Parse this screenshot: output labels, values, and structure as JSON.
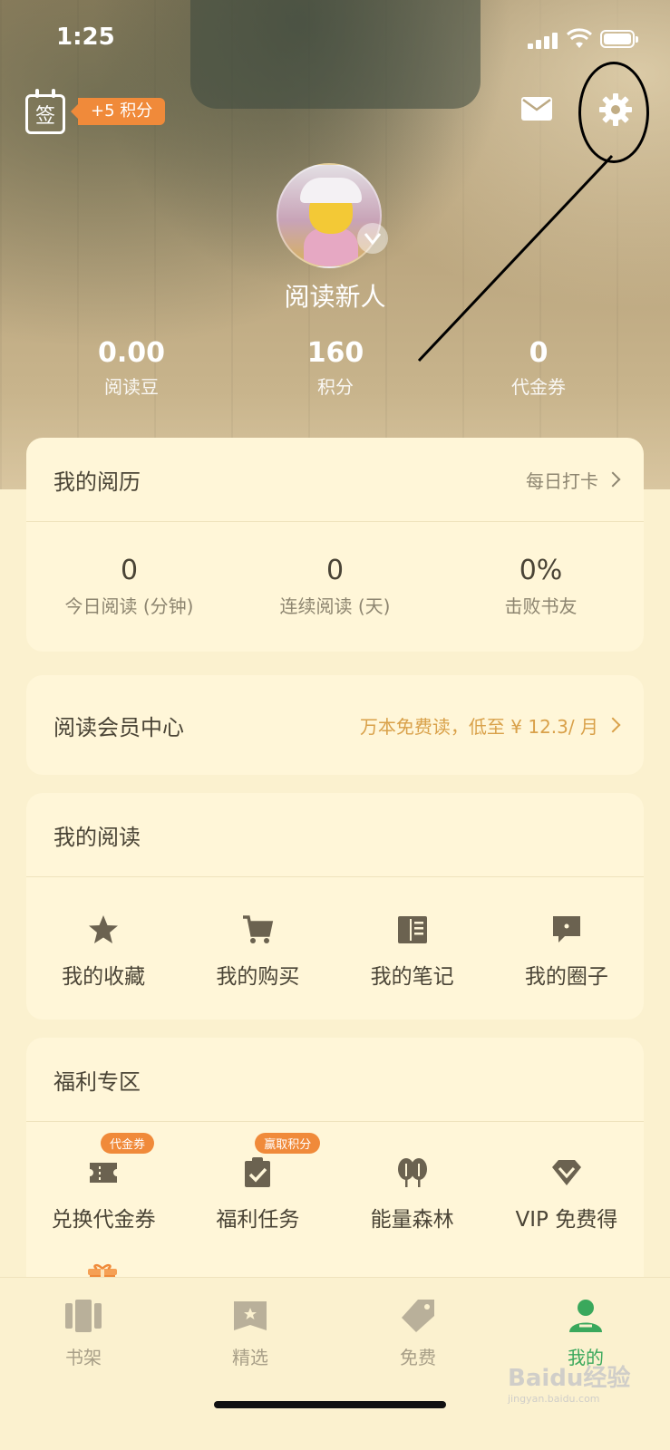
{
  "status": {
    "time": "1:25"
  },
  "header": {
    "checkin_glyph": "签",
    "points_badge": "+5 积分",
    "username": "阅读新人"
  },
  "stats": [
    {
      "value": "0.00",
      "label": "阅读豆"
    },
    {
      "value": "160",
      "label": "积分"
    },
    {
      "value": "0",
      "label": "代金券"
    }
  ],
  "history": {
    "title": "我的阅历",
    "action": "每日打卡",
    "items": [
      {
        "value": "0",
        "label": "今日阅读 (分钟)"
      },
      {
        "value": "0",
        "label": "连续阅读 (天)"
      },
      {
        "value": "0%",
        "label": "击败书友"
      }
    ]
  },
  "member": {
    "title": "阅读会员中心",
    "promo": "万本免费读，低至 ¥ 12.3/ 月"
  },
  "my_reading": {
    "title": "我的阅读",
    "items": [
      {
        "label": "我的收藏",
        "icon": "star-icon"
      },
      {
        "label": "我的购买",
        "icon": "cart-icon"
      },
      {
        "label": "我的笔记",
        "icon": "notebook-icon"
      },
      {
        "label": "我的圈子",
        "icon": "chat-bubble-icon"
      }
    ]
  },
  "welfare": {
    "title": "福利专区",
    "items": [
      {
        "label": "兑换代金券",
        "icon": "ticket-icon",
        "tag": "代金券"
      },
      {
        "label": "福利任务",
        "icon": "task-clipboard-icon",
        "tag": "赢取积分"
      },
      {
        "label": "能量森林",
        "icon": "trees-icon",
        "tag": ""
      },
      {
        "label": "VIP 免费得",
        "icon": "diamond-icon",
        "tag": ""
      }
    ],
    "extra_icon": "gift-icon"
  },
  "tabs": [
    {
      "label": "书架",
      "icon": "bookshelf-icon"
    },
    {
      "label": "精选",
      "icon": "featured-book-icon"
    },
    {
      "label": "免费",
      "icon": "price-tag-icon"
    },
    {
      "label": "我的",
      "icon": "profile-icon",
      "active": true
    }
  ],
  "watermark": {
    "brand": "Baidu经验",
    "url": "jingyan.baidu.com"
  },
  "colors": {
    "accent_orange": "#f08a3a",
    "active_green": "#3aa85c",
    "promo_gold": "#d9a14a",
    "card_bg": "#fff6d8"
  }
}
